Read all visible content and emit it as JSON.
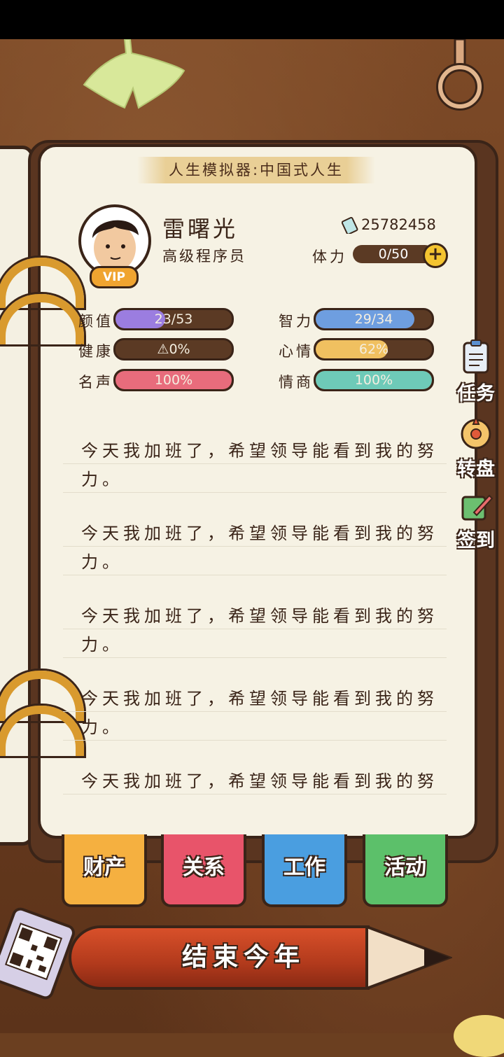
{
  "app": {
    "banner_title": "人生模拟器:中国式人生"
  },
  "profile": {
    "name": "雷曙光",
    "job": "高级程序员",
    "vip_badge": "VIP",
    "money": "25782458",
    "stamina_label": "体力",
    "stamina_value": "0/50",
    "stamina_add": "+"
  },
  "stats": [
    {
      "label": "颜值",
      "value": "23/53",
      "fill": 0.43,
      "color": "#9b7de0"
    },
    {
      "label": "智力",
      "value": "29/34",
      "fill": 0.85,
      "color": "#6e9ee0"
    },
    {
      "label": "健康",
      "value": "⚠0%",
      "fill": 0.0,
      "color": "#e05858"
    },
    {
      "label": "心情",
      "value": "62%",
      "fill": 0.62,
      "color": "#f0c060"
    },
    {
      "label": "名声",
      "value": "100%",
      "fill": 1.0,
      "color": "#e86c7c"
    },
    {
      "label": "情商",
      "value": "100%",
      "fill": 1.0,
      "color": "#6ecab8"
    }
  ],
  "log": [
    "今天我加班了，希望领导能看到我的努力。",
    "今天我加班了，希望领导能看到我的努力。",
    "今天我加班了，希望领导能看到我的努力。",
    "今天我加班了，希望领导能看到我的努力。",
    "今天我加班了，希望领导能看到我的努"
  ],
  "side_menu": [
    {
      "label": "任务",
      "icon": "clipboard-icon"
    },
    {
      "label": "转盘",
      "icon": "wheel-icon"
    },
    {
      "label": "签到",
      "icon": "checkin-icon"
    }
  ],
  "tabs": [
    {
      "label": "财产",
      "color": "#f5b040"
    },
    {
      "label": "关系",
      "color": "#e8546a"
    },
    {
      "label": "工作",
      "color": "#4a9ee0"
    },
    {
      "label": "活动",
      "color": "#5cc06a"
    }
  ],
  "end_year_button": "结束今年"
}
